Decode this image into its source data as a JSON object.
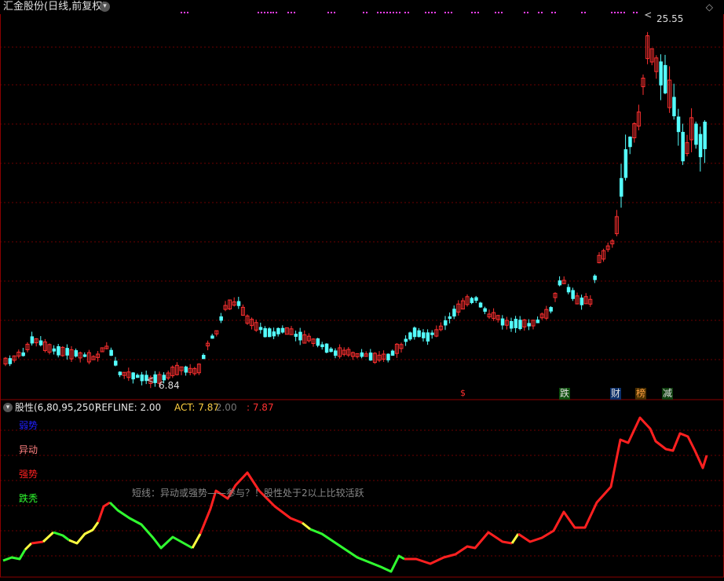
{
  "header": {
    "title": "汇金股份(日线,前复权)",
    "caret_icon": "chevron-down-icon",
    "corner_icon": "diamond-icon",
    "corner_glyph": "◇"
  },
  "price_chart": {
    "max_label": "25.55",
    "min_label": "6.84",
    "up_color": "#ff3030",
    "down_color": "#54ffff",
    "event_tags": {
      "s": "$",
      "die": "跌",
      "cai": "财",
      "bang": "榜",
      "jian": "减"
    }
  },
  "indicator": {
    "name": "股性(6,80,95,250)",
    "refline": "REFLINE: 2.00",
    "act": "ACT: 7.87",
    "value_2": ": 2.00",
    "value_3": ": 7.87",
    "legend": {
      "weak": "弱势",
      "move": "异动",
      "strong": "强势",
      "fall": "跌秃"
    },
    "hint": "短线：异动或强势——参与？！股性处于2以上比较活跃",
    "colors": {
      "weak": "#2020ff",
      "move": "#ff8080",
      "strong": "#ff2020",
      "fall": "#30ff30",
      "transition": "#ffff40"
    }
  }
}
